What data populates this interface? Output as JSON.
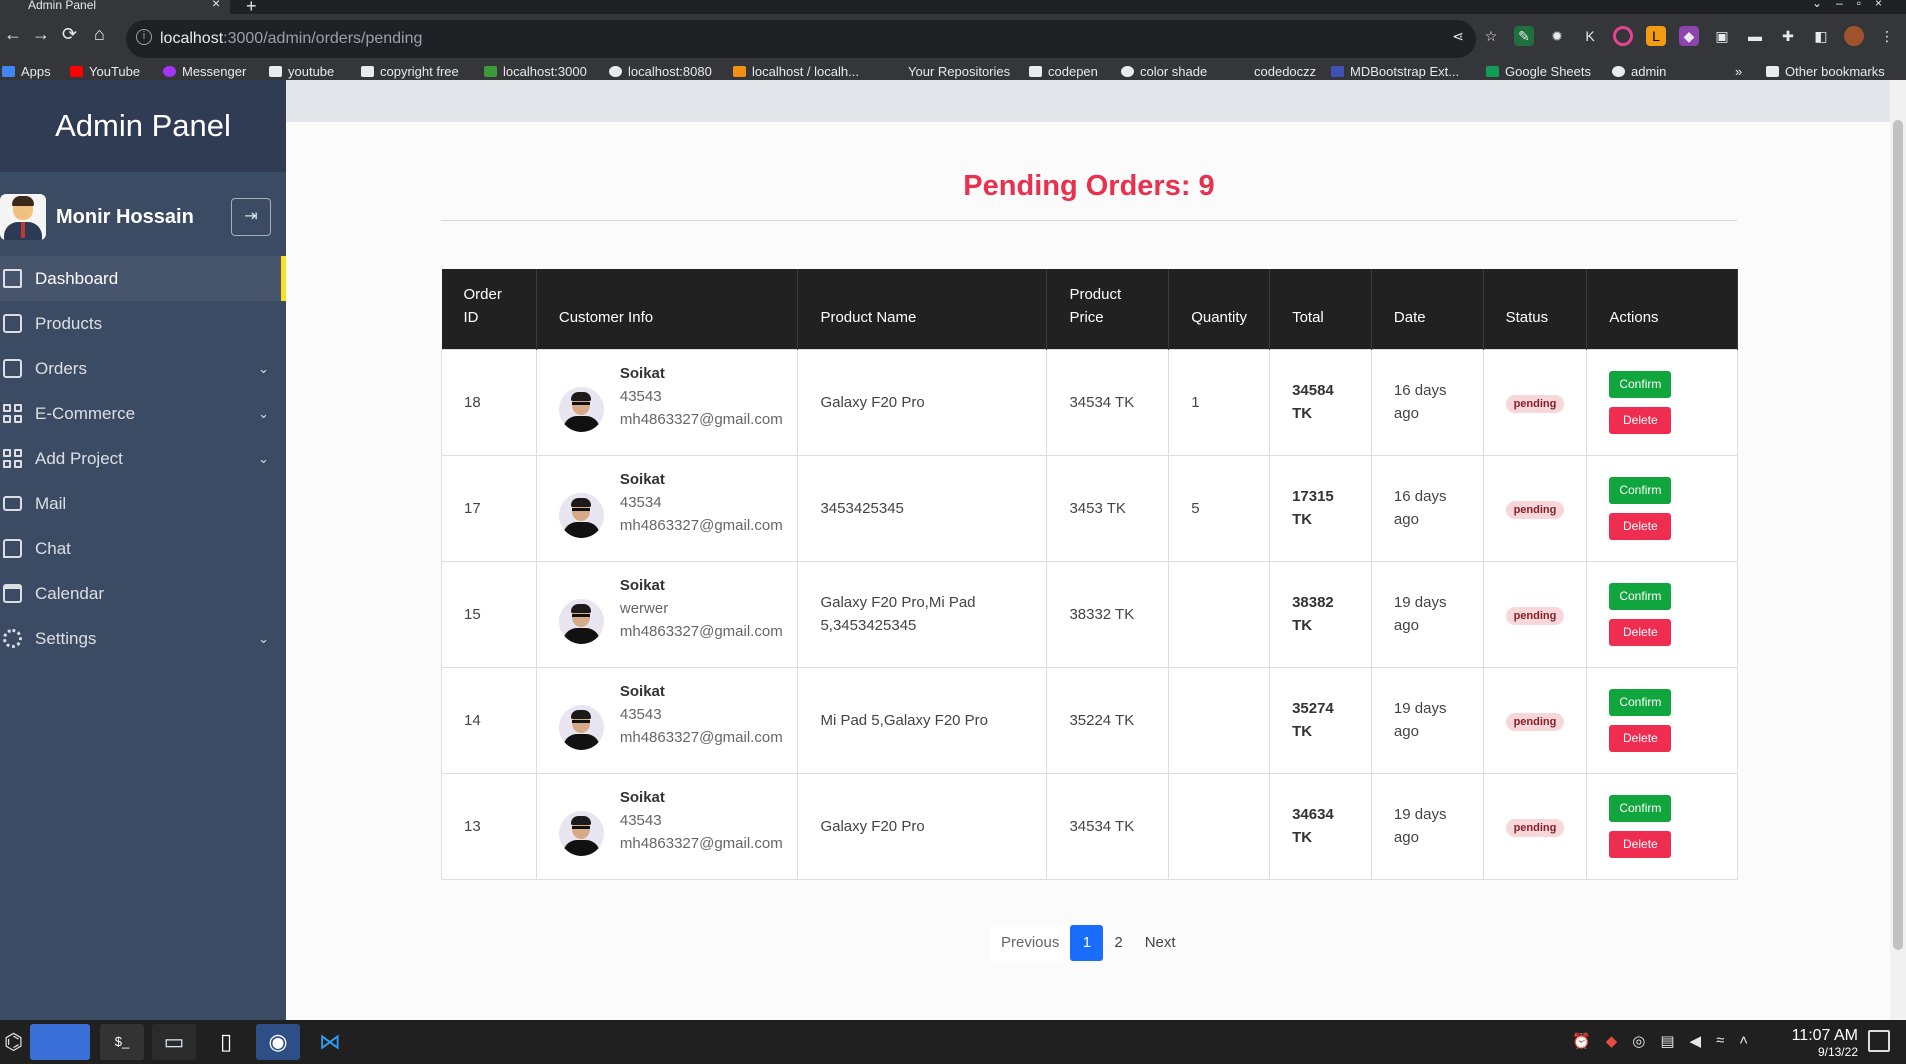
{
  "browser": {
    "tab_title": "Admin Panel",
    "url_host": "localhost",
    "url_path": ":3000/admin/orders/pending",
    "bookmarks": [
      {
        "label": "Apps",
        "color": "#4285f4"
      },
      {
        "label": "YouTube",
        "color": "#ff0000"
      },
      {
        "label": "Messenger",
        "color": "#a334fa"
      },
      {
        "label": "youtube",
        "color": "#e8eaed"
      },
      {
        "label": "copyright free",
        "color": "#e8eaed"
      },
      {
        "label": "localhost:3000",
        "color": "#3c9a3c"
      },
      {
        "label": "localhost:8080",
        "color": "#e8eaed"
      },
      {
        "label": "localhost / localh...",
        "color": "#f29111"
      },
      {
        "label": "Your Repositories",
        "color": "#35363a"
      },
      {
        "label": "codepen",
        "color": "#e8eaed"
      },
      {
        "label": "color shade",
        "color": "#e8eaed"
      },
      {
        "label": "codedoczz",
        "color": "#35363a"
      },
      {
        "label": "MDBootstrap Ext...",
        "color": "#3f51b5"
      },
      {
        "label": "Google Sheets",
        "color": "#0f9d58"
      },
      {
        "label": "admin",
        "color": "#e8eaed"
      }
    ],
    "other_bookmarks": "Other bookmarks"
  },
  "sidebar": {
    "brand": "Admin Panel",
    "user_name": "Monir Hossain",
    "items": [
      {
        "label": "Dashboard",
        "icon": "home-icon",
        "active": true
      },
      {
        "label": "Products",
        "icon": "bag-icon"
      },
      {
        "label": "Orders",
        "icon": "chart-icon",
        "expandable": true
      },
      {
        "label": "E-Commerce",
        "icon": "grid-icon",
        "expandable": true
      },
      {
        "label": "Add Project",
        "icon": "grid-icon",
        "expandable": true
      },
      {
        "label": "Mail",
        "icon": "mail-icon"
      },
      {
        "label": "Chat",
        "icon": "chat-icon"
      },
      {
        "label": "Calendar",
        "icon": "calendar-icon"
      },
      {
        "label": "Settings",
        "icon": "gear-icon",
        "expandable": true
      }
    ]
  },
  "main": {
    "title": "Pending Orders: 9",
    "table": {
      "headers": {
        "order_id_1": "Order",
        "order_id_2": "ID",
        "customer": "Customer Info",
        "product": "Product Name",
        "price_1": "Product",
        "price_2": "Price",
        "quantity": "Quantity",
        "total": "Total",
        "date": "Date",
        "status": "Status",
        "actions": "Actions"
      },
      "rows": [
        {
          "id": "18",
          "name": "Soikat",
          "line2": "43543",
          "email": "mh4863327@gmail.com",
          "product": "Galaxy F20 Pro",
          "price": "34534 TK",
          "quantity": "1",
          "total_num": "34584",
          "total_unit": "TK",
          "date_1": "16 days",
          "date_2": "ago",
          "status": "pending"
        },
        {
          "id": "17",
          "name": "Soikat",
          "line2": "43534",
          "email": "mh4863327@gmail.com",
          "product": "3453425345",
          "price": "3453 TK",
          "quantity": "5",
          "total_num": "17315",
          "total_unit": "TK",
          "date_1": "16 days",
          "date_2": "ago",
          "status": "pending"
        },
        {
          "id": "15",
          "name": "Soikat",
          "line2": "werwer",
          "email": "mh4863327@gmail.com",
          "product": "Galaxy F20 Pro,Mi Pad 5,3453425345",
          "price": "38332 TK",
          "quantity": "",
          "total_num": "38382",
          "total_unit": "TK",
          "date_1": "19 days",
          "date_2": "ago",
          "status": "pending"
        },
        {
          "id": "14",
          "name": "Soikat",
          "line2": "43543",
          "email": "mh4863327@gmail.com",
          "product": "Mi Pad 5,Galaxy F20 Pro",
          "price": "35224 TK",
          "quantity": "",
          "total_num": "35274",
          "total_unit": "TK",
          "date_1": "19 days",
          "date_2": "ago",
          "status": "pending"
        },
        {
          "id": "13",
          "name": "Soikat",
          "line2": "43543",
          "email": "mh4863327@gmail.com",
          "product": "Galaxy F20 Pro",
          "price": "34534 TK",
          "quantity": "",
          "total_num": "34634",
          "total_unit": "TK",
          "date_1": "19 days",
          "date_2": "ago",
          "status": "pending"
        }
      ],
      "confirm_label": "Confirm",
      "delete_label": "Delete"
    },
    "pagination": {
      "previous": "Previous",
      "pages": [
        "1",
        "2"
      ],
      "current": "1",
      "next": "Next"
    }
  },
  "taskbar": {
    "time": "11:07 AM",
    "date": "9/13/22"
  },
  "colors": {
    "sidebar_bg": "#3c4b64",
    "accent_red": "#e8314f",
    "confirm_green": "#11a63d",
    "delete_red": "#ee2d50",
    "active_marker": "#f9e21b",
    "page_blue": "#1a6dfb"
  }
}
